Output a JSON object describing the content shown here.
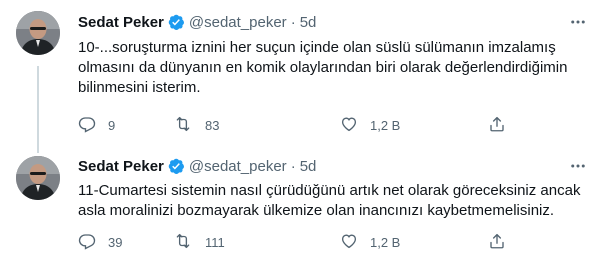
{
  "tweets": [
    {
      "author_name": "Sedat Peker",
      "handle": "@sedat_peker",
      "separator": "·",
      "time": "5d",
      "text": "10-...soruşturma iznini her suçun içinde olan süslü sülümanın imzalamış olmasını da dünyanın en komik olaylarından biri olarak değerlendirdiğimin bilinmesini isterim.",
      "replies": "9",
      "retweets": "83",
      "likes": "1,2 B",
      "verified": true
    },
    {
      "author_name": "Sedat Peker",
      "handle": "@sedat_peker",
      "separator": "·",
      "time": "5d",
      "text": "11-Cumartesi sistemin nasıl çürüdüğünü artık net olarak göreceksiniz ancak asla moralinizi bozmayarak ülkemize olan inancınızı kaybetmemelisiniz.",
      "replies": "39",
      "retweets": "111",
      "likes": "1,2 B",
      "verified": true
    }
  ],
  "icons": {
    "verified": "verified-badge-icon",
    "more": "more-icon",
    "reply": "reply-icon",
    "retweet": "retweet-icon",
    "like": "like-icon",
    "share": "share-icon"
  },
  "colors": {
    "text": "#0f1419",
    "secondary": "#536471",
    "verified": "#1d9bf0",
    "thread_line": "#cfd9de"
  }
}
